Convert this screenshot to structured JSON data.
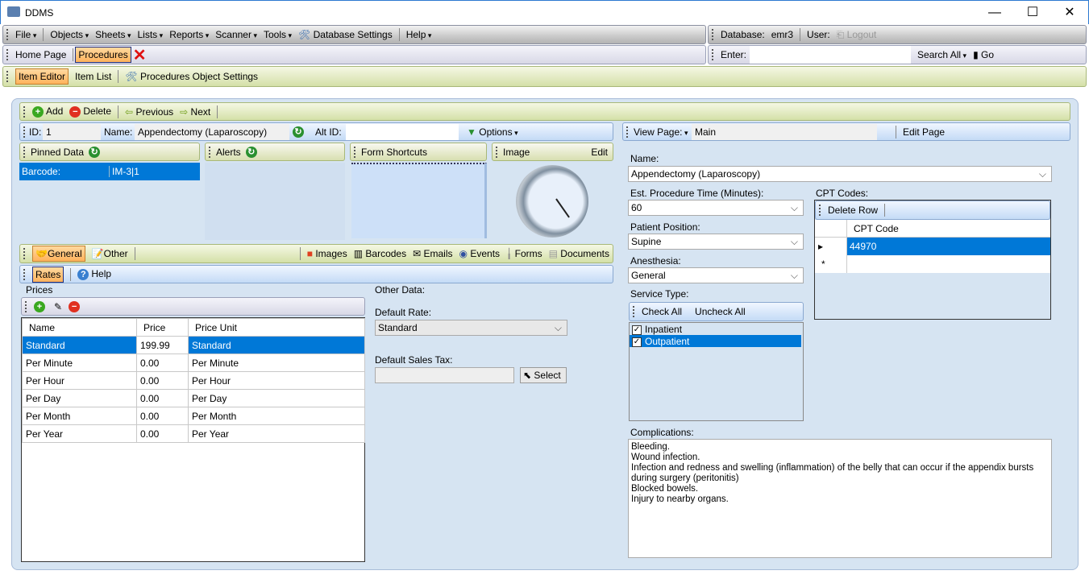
{
  "window": {
    "title": "DDMS",
    "min": "—",
    "max": "☐",
    "close": "✕"
  },
  "menu": [
    "File",
    "Objects",
    "Sheets",
    "Lists",
    "Reports",
    "Scanner",
    "Tools"
  ],
  "menu_db_settings": "Database Settings",
  "menu_help": "Help",
  "status": {
    "database_label": "Database:",
    "database_value": "emr3",
    "user_label": "User:",
    "logout": "Logout"
  },
  "tabs": {
    "home": "Home Page",
    "procedures": "Procedures"
  },
  "search": {
    "enter_label": "Enter:",
    "value": "",
    "scope": "Search All",
    "go": "Go"
  },
  "subnav": {
    "item_editor": "Item Editor",
    "item_list": "Item List",
    "settings": "Procedures Object Settings"
  },
  "toolbar": {
    "add": "Add",
    "delete": "Delete",
    "previous": "Previous",
    "next": "Next"
  },
  "record": {
    "id_label": "ID:",
    "id": "1",
    "name_label": "Name:",
    "name": "Appendectomy (Laparoscopy)",
    "alt_id_label": "Alt ID:",
    "alt_id": "",
    "options": "Options"
  },
  "panels": {
    "pinned": "Pinned Data",
    "alerts": "Alerts",
    "form_shortcuts": "Form Shortcuts",
    "image": "Image",
    "image_edit": "Edit"
  },
  "pinned": [
    {
      "key": "Barcode:",
      "value": "IM-3|1"
    }
  ],
  "section_tabs": {
    "general": "General",
    "other": "Other",
    "images": "Images",
    "barcodes": "Barcodes",
    "emails": "Emails",
    "events": "Events",
    "forms": "Forms",
    "documents": "Documents"
  },
  "sub_tabs": {
    "rates": "Rates",
    "help": "Help"
  },
  "prices": {
    "title": "Prices",
    "columns": [
      "Name",
      "Price",
      "Price Unit"
    ],
    "rows": [
      [
        "Standard",
        "199.99",
        "Standard"
      ],
      [
        "Per Minute",
        "0.00",
        "Per Minute"
      ],
      [
        "Per Hour",
        "0.00",
        "Per Hour"
      ],
      [
        "Per Day",
        "0.00",
        "Per Day"
      ],
      [
        "Per Month",
        "0.00",
        "Per Month"
      ],
      [
        "Per Year",
        "0.00",
        "Per Year"
      ]
    ]
  },
  "other_data": {
    "title": "Other Data:",
    "default_rate_label": "Default Rate:",
    "default_rate": "Standard",
    "sales_tax_label": "Default Sales Tax:",
    "sales_tax": "",
    "select": "Select"
  },
  "view": {
    "label": "View Page:",
    "page": "Main",
    "edit": "Edit Page"
  },
  "form": {
    "name_label": "Name:",
    "name": "Appendectomy (Laparoscopy)",
    "time_label": "Est. Procedure Time (Minutes):",
    "time": "60",
    "position_label": "Patient Position:",
    "position": "Supine",
    "anesthesia_label": "Anesthesia:",
    "anesthesia": "General",
    "service_label": "Service Type:",
    "check_all": "Check All",
    "uncheck_all": "Uncheck All",
    "services": [
      {
        "label": "Inpatient",
        "checked": true
      },
      {
        "label": "Outpatient",
        "checked": true
      }
    ],
    "cpt_label": "CPT Codes:",
    "delete_row": "Delete Row",
    "cpt_header": "CPT Code",
    "cpt_rows": [
      "44970"
    ],
    "complications_label": "Complications:",
    "complications": [
      "Bleeding.",
      "Wound infection.",
      "Infection and redness and swelling (inflammation) of the belly that can occur if the appendix bursts during surgery (peritonitis)",
      "Blocked bowels.",
      "Injury to nearby organs."
    ]
  },
  "colors": {
    "selection": "#0078d7",
    "accent_orange": "#ffb35c"
  }
}
